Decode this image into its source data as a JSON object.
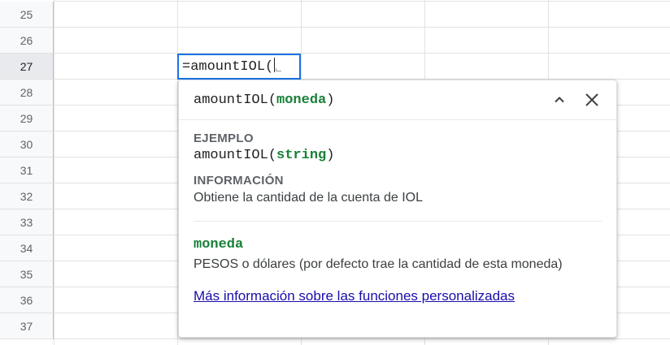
{
  "rows": [
    "25",
    "26",
    "27",
    "28",
    "29",
    "30",
    "31",
    "32",
    "33",
    "34",
    "35",
    "36",
    "37"
  ],
  "active_row": "27",
  "cell_editor": {
    "formula": "=amountIOL("
  },
  "popup": {
    "signature_fn": "amountIOL(",
    "signature_param": "moneda",
    "signature_close": ")",
    "example_label": "EJEMPLO",
    "example_fn": "amountIOL(",
    "example_arg": "string",
    "example_close": ")",
    "info_label": "INFORMACIÓN",
    "info_text": "Obtiene la cantidad de la cuenta de IOL",
    "arg_name": "moneda",
    "arg_desc": "PESOS o dólares (por defecto trae la cantidad de esta moneda)",
    "more_link": "Más información sobre las funciones personalizadas"
  },
  "colors": {
    "accent": "#1a73e8",
    "param_green": "#188038",
    "link": "#1a0dab"
  },
  "icons": {
    "collapse": "chevron-up-icon",
    "close": "close-icon"
  }
}
